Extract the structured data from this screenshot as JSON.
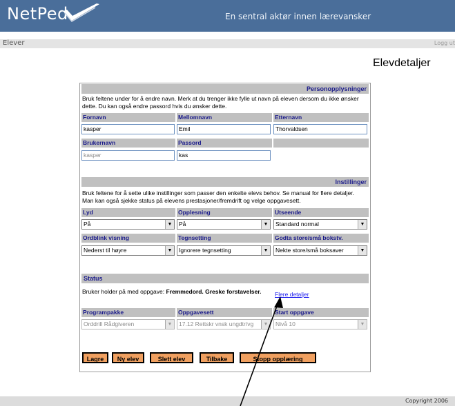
{
  "header": {
    "logo": "NetPed",
    "tagline": "En sentral aktør innen lærevansker",
    "colors": {
      "header_bg": "#4a6e9a",
      "accent_orange": "#f0a060",
      "section_bar": "#c0c0c0",
      "label_text": "#1a1a8a"
    }
  },
  "subnav": {
    "left": "Elever",
    "right": "Logg ut"
  },
  "page_title": "Elevdetaljer",
  "personal": {
    "section": "Personopplysninger",
    "description": "Bruk feltene under for å endre navn. Merk at du trenger ikke fylle ut navn på eleven dersom du ikke ønsker dette. Du kan også endre passord hvis du ønsker dette.",
    "first_name_label": "Fornavn",
    "first_name": "kasper",
    "middle_name_label": "Mellomnavn",
    "middle_name": "Emil",
    "last_name_label": "Etternavn",
    "last_name": "Thorvaldsen",
    "username_label": "Brukernavn",
    "username": "kasper",
    "password_label": "Passord",
    "password": "kas"
  },
  "settings": {
    "section": "Instillinger",
    "description": "Bruk feltene for å sette ulike instillinger som passer den enkelte elevs behov. Se manual for flere detaljer. Man kan også sjekke status på elevens prestasjoner/fremdrift og velge oppgavesett.",
    "sound_label": "Lyd",
    "sound": "På",
    "reading_label": "Opplesning",
    "reading": "På",
    "appearance_label": "Utseende",
    "appearance": "Standard normal",
    "ordblink_label": "Ordblink visning",
    "ordblink": "Nederst til høyre",
    "punct_label": "Tegnsetting",
    "punct": "Ignorere tegnsetting",
    "case_label": "Godta store/små bokstv.",
    "case": "Nekte store/små boksaver"
  },
  "status": {
    "section": "Status",
    "text_prefix": "Bruker holder på med oppgave:",
    "task": "Fremmedord. Greske forstavelser.",
    "details_link": "Flere detaljer",
    "program_label": "Programpakke",
    "program": "Orddrill Rådgiveren",
    "taskset_label": "Oppgavesett",
    "taskset": "17.12 Rettskr vnsk ungdtr/vg",
    "start_label": "Start oppgave",
    "start": "Nivå 10"
  },
  "buttons": {
    "save": "Lagre",
    "new": "Ny elev",
    "delete": "Slett elev",
    "back": "Tilbake",
    "stop": "Stopp opplæring"
  },
  "footer": {
    "copyright": "Copyright 2006"
  }
}
